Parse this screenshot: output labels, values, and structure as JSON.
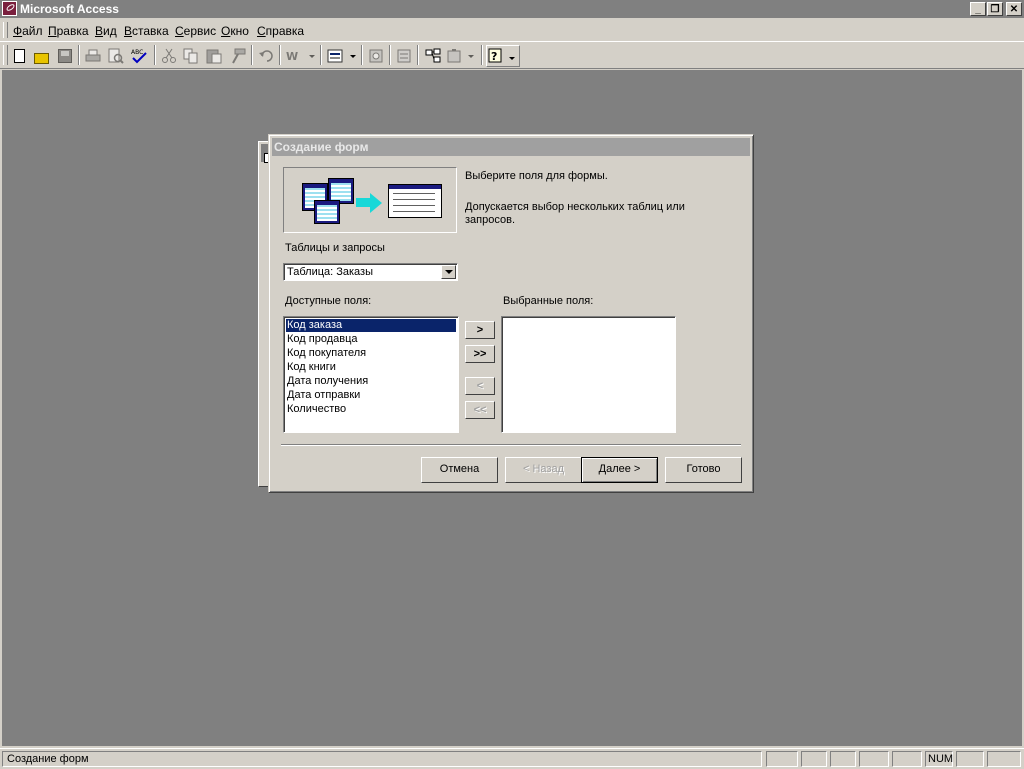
{
  "window": {
    "title": "Microsoft Access"
  },
  "window_controls": {
    "minimize": "_",
    "restore": "❐",
    "close": "✕"
  },
  "menu": {
    "items": [
      {
        "label": "Файл",
        "accel": "Ф",
        "rest": "айл"
      },
      {
        "label": "Правка",
        "accel": "П",
        "rest": "равка"
      },
      {
        "label": "Вид",
        "accel": "В",
        "rest": "ид"
      },
      {
        "label": "Вставка",
        "accel": "В",
        "rest": "ставка"
      },
      {
        "label": "Сервис",
        "accel": "С",
        "rest": "ервис"
      },
      {
        "label": "Окно",
        "accel": "О",
        "rest": "кно"
      },
      {
        "label": "Справка",
        "accel": "С",
        "rest": "правка"
      }
    ]
  },
  "toolbar": {
    "icons": [
      "new-icon",
      "open-icon",
      "save-icon",
      "print-icon",
      "print-preview-icon",
      "spelling-icon",
      "cut-icon",
      "copy-icon",
      "paste-icon",
      "format-painter-icon",
      "undo-icon",
      "office-links-icon",
      "analyze-icon",
      "properties-icon",
      "relationships-icon",
      "new-object-icon",
      "help-icon"
    ]
  },
  "dialog": {
    "title": "Создание форм",
    "instruction": "Выберите поля для формы.",
    "note": "Допускается выбор нескольких таблиц или запросов.",
    "tables_label": "Таблицы и запросы",
    "tables_value": "Таблица: Заказы",
    "available_label": "Доступные поля:",
    "selected_label": "Выбранные поля:",
    "available_fields": [
      "Код заказа",
      "Код продавца",
      "Код покупателя",
      "Код книги",
      "Дата получения",
      "Дата отправки",
      "Количество"
    ],
    "selected_fields": [],
    "move_buttons": {
      "add_one": ">",
      "add_all": ">>",
      "remove_one": "<",
      "remove_all": "<<"
    },
    "buttons": {
      "cancel": "Отмена",
      "back": "< Назад",
      "next": "Далее >",
      "finish": "Готово"
    }
  },
  "statusbar": {
    "message": "Создание форм",
    "num": "NUM"
  }
}
